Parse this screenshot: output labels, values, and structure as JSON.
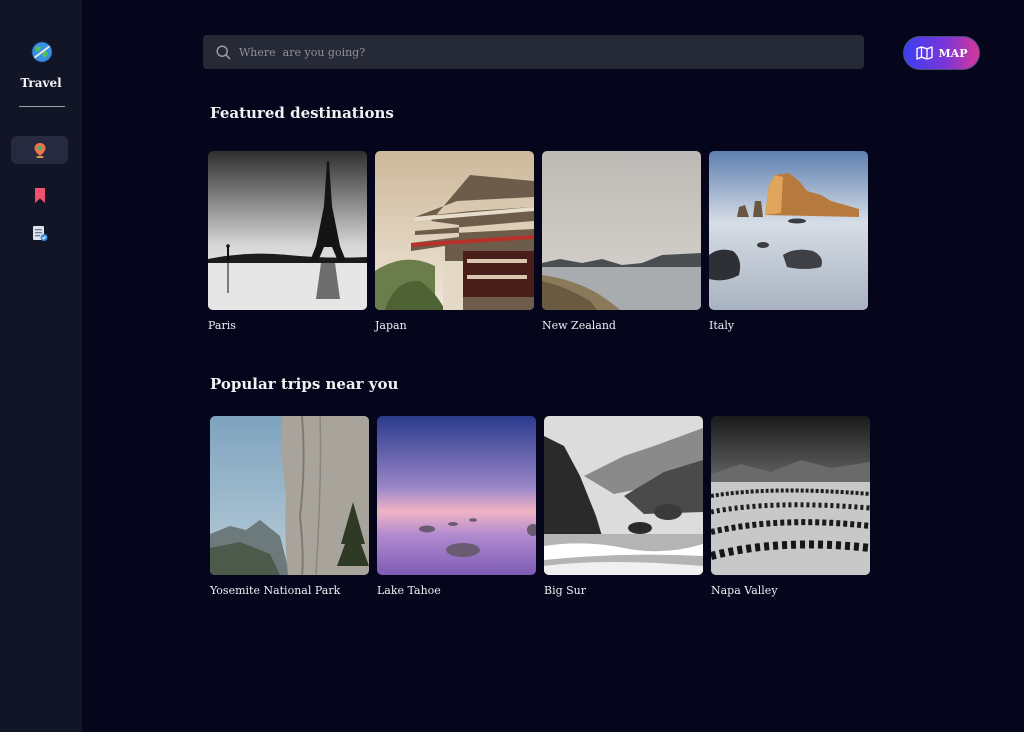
{
  "sidebar": {
    "app_title": "Travel",
    "logo_icon": "globe-icon",
    "items": [
      {
        "icon": "location-pin-icon",
        "active": true
      },
      {
        "icon": "bookmark-icon",
        "active": false
      },
      {
        "icon": "itinerary-icon",
        "active": false
      }
    ]
  },
  "search": {
    "placeholder": "Where  are you going?",
    "value": "",
    "icon": "search-icon"
  },
  "map_button": {
    "label": "MAP",
    "icon": "map-icon",
    "gradient": [
      "#3b3ff0",
      "#7a36d8",
      "#d6369a"
    ]
  },
  "featured": {
    "title": "Featured destinations",
    "items": [
      {
        "name": "Paris"
      },
      {
        "name": "Japan"
      },
      {
        "name": "New Zealand"
      },
      {
        "name": "Italy"
      }
    ]
  },
  "popular": {
    "title": "Popular trips near you",
    "items": [
      {
        "name": "Yosemite National Park"
      },
      {
        "name": "Lake Tahoe"
      },
      {
        "name": "Big Sur"
      },
      {
        "name": "Napa Valley"
      }
    ]
  },
  "colors": {
    "background": "#05061c",
    "sidebar": "#121525",
    "search_bar": "#262a37",
    "active_nav": "#272a3e"
  }
}
